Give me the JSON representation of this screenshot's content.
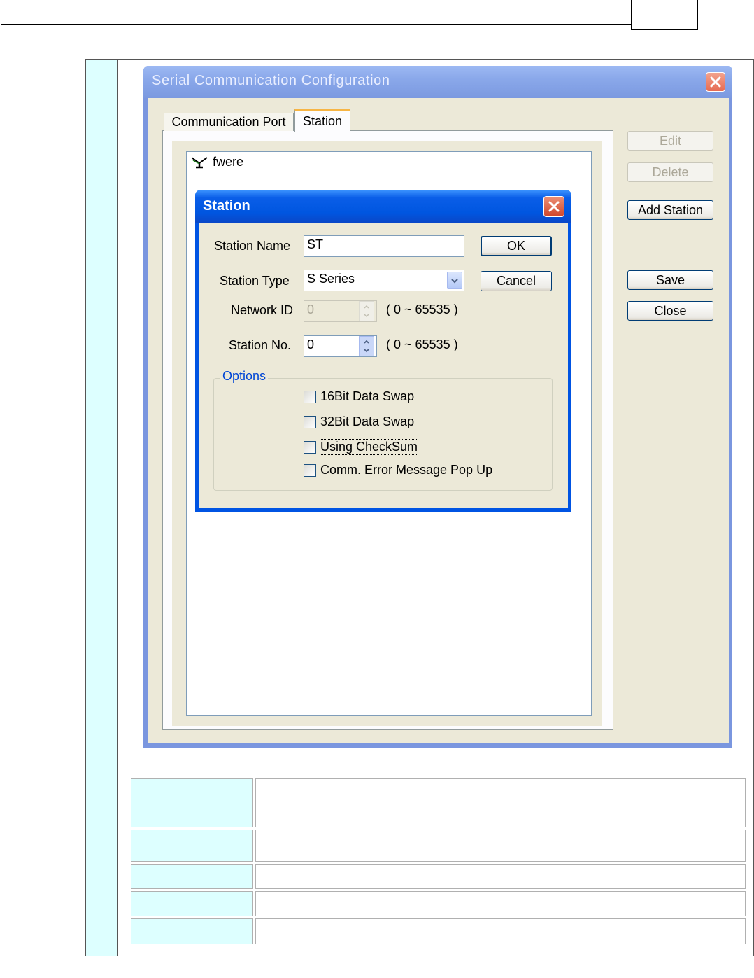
{
  "window": {
    "title": "Serial Communication Configuration",
    "tabs": [
      {
        "label": "Communication Port",
        "active": false
      },
      {
        "label": "Station",
        "active": true
      }
    ],
    "tree_item": "fwere",
    "buttons": {
      "edit": "Edit",
      "delete": "Delete",
      "add_station": "Add Station",
      "save": "Save",
      "close": "Close"
    }
  },
  "dialog": {
    "title": "Station",
    "station_name_label": "Station Name",
    "station_name_value": "ST",
    "station_type_label": "Station Type",
    "station_type_value": "S Series",
    "network_id_label": "Network ID",
    "network_id_value": "0",
    "network_id_range": "( 0 ~ 65535 )",
    "station_no_label": "Station No.",
    "station_no_value": "0",
    "station_no_range": "( 0 ~ 65535 )",
    "ok": "OK",
    "cancel": "Cancel",
    "options_label": "Options",
    "options": [
      {
        "label": "16Bit Data Swap",
        "checked": false
      },
      {
        "label": "32Bit Data Swap",
        "checked": false
      },
      {
        "label": "Using CheckSum",
        "checked": false
      },
      {
        "label": "Comm. Error Message Pop Up",
        "checked": false
      }
    ]
  },
  "colors": {
    "xp_blue": "#0054e3",
    "table_cyan": "#ddffff",
    "dialog_face": "#ece9d8"
  }
}
